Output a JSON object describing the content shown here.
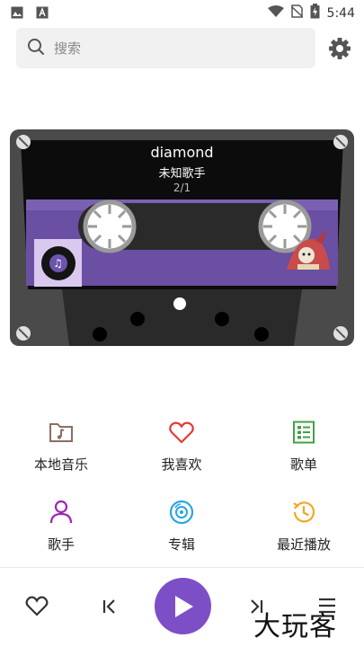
{
  "status_bar": {
    "time": "5:44",
    "left_icons": [
      "image-icon",
      "text-app-icon"
    ],
    "right_icons": [
      "wifi-icon",
      "no-sim-icon",
      "battery-charging-icon"
    ]
  },
  "search": {
    "placeholder": "搜索",
    "search_icon": "search-icon",
    "settings_icon": "gear-icon"
  },
  "player_card": {
    "song_title": "diamond",
    "artist": "未知歌手",
    "track_counter": "2/1",
    "accent_color": "#7d4fc6"
  },
  "grid": [
    {
      "label": "本地音乐",
      "icon": "folder-music-icon",
      "color": "#8d6e63"
    },
    {
      "label": "我喜欢",
      "icon": "heart-icon",
      "color": "#e53935"
    },
    {
      "label": "歌单",
      "icon": "playlist-icon",
      "color": "#43a047"
    },
    {
      "label": "歌手",
      "icon": "person-icon",
      "color": "#9c27b0"
    },
    {
      "label": "专辑",
      "icon": "disc-icon",
      "color": "#29a6e0"
    },
    {
      "label": "最近播放",
      "icon": "history-icon",
      "color": "#f5a623"
    }
  ],
  "bottom_bar": {
    "controls": [
      "heart-icon",
      "previous-icon",
      "play-icon",
      "next-icon",
      "queue-icon"
    ]
  },
  "watermark": "大玩客"
}
